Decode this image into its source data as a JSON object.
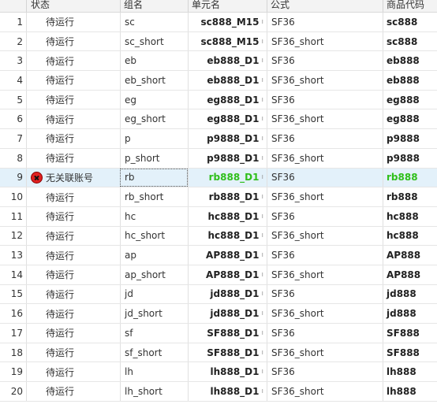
{
  "headers": {
    "status": "状态",
    "group": "组名",
    "unit": "单元名",
    "formula": "公式",
    "code": "商品代码"
  },
  "rows": [
    {
      "num": "1",
      "status": "待运行",
      "group": "sc",
      "unit": "sc888_M15",
      "formula": "SF36",
      "code": "sc888"
    },
    {
      "num": "2",
      "status": "待运行",
      "group": "sc_short",
      "unit": "sc888_M15",
      "formula": "SF36_short",
      "code": "sc888"
    },
    {
      "num": "3",
      "status": "待运行",
      "group": "eb",
      "unit": "eb888_D1",
      "formula": "SF36",
      "code": "eb888"
    },
    {
      "num": "4",
      "status": "待运行",
      "group": "eb_short",
      "unit": "eb888_D1",
      "formula": "SF36_short",
      "code": "eb888"
    },
    {
      "num": "5",
      "status": "待运行",
      "group": "eg",
      "unit": "eg888_D1",
      "formula": "SF36",
      "code": "eg888"
    },
    {
      "num": "6",
      "status": "待运行",
      "group": "eg_short",
      "unit": "eg888_D1",
      "formula": "SF36_short",
      "code": "eg888"
    },
    {
      "num": "7",
      "status": "待运行",
      "group": "p",
      "unit": "p9888_D1",
      "formula": "SF36",
      "code": "p9888"
    },
    {
      "num": "8",
      "status": "待运行",
      "group": "p_short",
      "unit": "p9888_D1",
      "formula": "SF36_short",
      "code": "p9888"
    },
    {
      "num": "9",
      "status": "无关联账号",
      "group": "rb",
      "unit": "rb888_D1",
      "formula": "SF36",
      "code": "rb888",
      "selected": true,
      "error": true
    },
    {
      "num": "10",
      "status": "待运行",
      "group": "rb_short",
      "unit": "rb888_D1",
      "formula": "SF36_short",
      "code": "rb888"
    },
    {
      "num": "11",
      "status": "待运行",
      "group": "hc",
      "unit": "hc888_D1",
      "formula": "SF36",
      "code": "hc888"
    },
    {
      "num": "12",
      "status": "待运行",
      "group": "hc_short",
      "unit": "hc888_D1",
      "formula": "SF36_short",
      "code": "hc888"
    },
    {
      "num": "13",
      "status": "待运行",
      "group": "ap",
      "unit": "AP888_D1",
      "formula": "SF36",
      "code": "AP888"
    },
    {
      "num": "14",
      "status": "待运行",
      "group": "ap_short",
      "unit": "AP888_D1",
      "formula": "SF36_short",
      "code": "AP888"
    },
    {
      "num": "15",
      "status": "待运行",
      "group": "jd",
      "unit": "jd888_D1",
      "formula": "SF36",
      "code": "jd888"
    },
    {
      "num": "16",
      "status": "待运行",
      "group": "jd_short",
      "unit": "jd888_D1",
      "formula": "SF36_short",
      "code": "jd888"
    },
    {
      "num": "17",
      "status": "待运行",
      "group": "sf",
      "unit": "SF888_D1",
      "formula": "SF36",
      "code": "SF888"
    },
    {
      "num": "18",
      "status": "待运行",
      "group": "sf_short",
      "unit": "SF888_D1",
      "formula": "SF36_short",
      "code": "SF888"
    },
    {
      "num": "19",
      "status": "待运行",
      "group": "lh",
      "unit": "lh888_D1",
      "formula": "SF36",
      "code": "lh888"
    },
    {
      "num": "20",
      "status": "待运行",
      "group": "lh_short",
      "unit": "lh888_D1",
      "formula": "SF36_short",
      "code": "lh888"
    }
  ],
  "unit_overflow_mark": "ı",
  "colors": {
    "selected_row_bg": "#e3f1fa",
    "selected_text": "#2fbf1a",
    "error_icon": "#e02020"
  },
  "icons": {
    "error": "error-circle-icon"
  }
}
